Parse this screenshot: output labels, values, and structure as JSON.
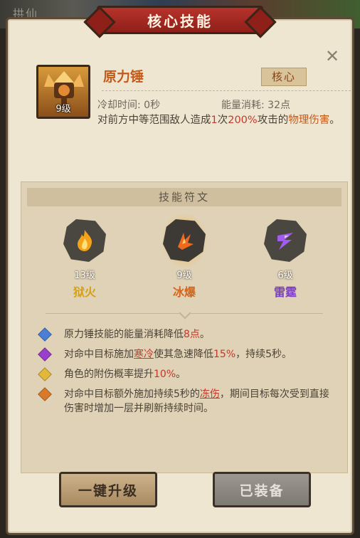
{
  "background": {
    "text": "拱仙"
  },
  "dialog": {
    "title": "核心技能",
    "close_glyph": "✕"
  },
  "skill": {
    "name": "原力锤",
    "level": "9级",
    "badge": "核心",
    "cooldown": "冷却时间: 0秒",
    "energy": "能量消耗: 32点",
    "desc": {
      "p1": "对前方中等范围敌人造成",
      "count": "1",
      "p2": "次",
      "percent": "200%",
      "p3": "攻击的",
      "dmg": "物理伤害",
      "p4": "。"
    }
  },
  "runes": {
    "header": "技能符文",
    "items": [
      {
        "level": "13级",
        "name": "狱火",
        "color": "#d4a017",
        "icon": "flame-icon"
      },
      {
        "level": "9级",
        "name": "冰爆",
        "color": "#d2661e",
        "icon": "burst-icon"
      },
      {
        "level": "6级",
        "name": "雷霆",
        "color": "#7b3fc0",
        "icon": "lightning-icon"
      }
    ],
    "effects": [
      {
        "gem": "#4a7fd4",
        "parts": [
          "原力锤技能的能量消耗降低",
          "8点",
          "。"
        ]
      },
      {
        "gem": "#9a3fc9",
        "parts": [
          "对命中目标施加",
          "寒冷",
          "使其急速降低",
          "15%",
          "，持续5秒。"
        ]
      },
      {
        "gem": "#e1b83c",
        "parts": [
          "角色的附伤概率提升",
          "10%",
          "。"
        ]
      },
      {
        "gem": "#d87a2a",
        "parts": [
          "对命中目标额外施加持续5秒的",
          "冻伤",
          "，期间目标每次受到直接伤害时增加一层并刷新持续时间。"
        ]
      }
    ]
  },
  "buttons": {
    "upgrade": "一键升级",
    "equipped": "已装备"
  }
}
